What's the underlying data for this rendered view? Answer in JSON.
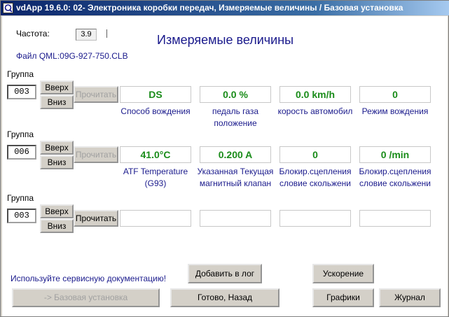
{
  "window": {
    "title": "vdApp 19.6.0: 02- Электроника коробки передач,  Измеряемые величины / Базовая установка"
  },
  "header": {
    "frequency_label": "Частота:",
    "frequency_value": "3.9",
    "file_label": "Файл QML:09G-927-750.CLB",
    "heading": "Измеряемые величины"
  },
  "group_label": "Группа",
  "buttons": {
    "up": "Вверх",
    "down": "Вниз",
    "read": "Прочитать"
  },
  "groups": [
    {
      "number": "003",
      "read_enabled": false,
      "values": [
        "DS",
        "0.0 %",
        "0.0 km/h",
        "0"
      ],
      "labels": [
        [
          "Способ вождения"
        ],
        [
          "педаль газа",
          "положение"
        ],
        [
          "корость автомобил"
        ],
        [
          "Режим вождения"
        ]
      ]
    },
    {
      "number": "006",
      "read_enabled": false,
      "values": [
        "41.0°C",
        "0.200 A",
        "0",
        "0 /min"
      ],
      "labels": [
        [
          "ATF Temperature",
          "(G93)"
        ],
        [
          "Указанная Текущая",
          "магнитный клапан"
        ],
        [
          "Блокир.сцепления",
          "словие скольжени"
        ],
        [
          "Блокир.сцепления",
          "словие скольжени"
        ]
      ]
    },
    {
      "number": "003",
      "read_enabled": true,
      "values": [
        "",
        "",
        "",
        ""
      ],
      "labels": [
        [],
        [],
        [],
        []
      ]
    }
  ],
  "footer": {
    "service_doc_text": "Используйте сервисную документацию!",
    "add_to_log": "Добавить в лог",
    "acceleration": "Ускорение",
    "basic_setting": "-> Базовая установка",
    "done_back": "Готово, Назад",
    "graphs": "Графики",
    "journal": "Журнал"
  },
  "colors": {
    "title_bar": "#0a246a",
    "value_text": "#1a8c1a",
    "label_text": "#1a1a8c",
    "disabled_text": "#a0a0a0"
  }
}
